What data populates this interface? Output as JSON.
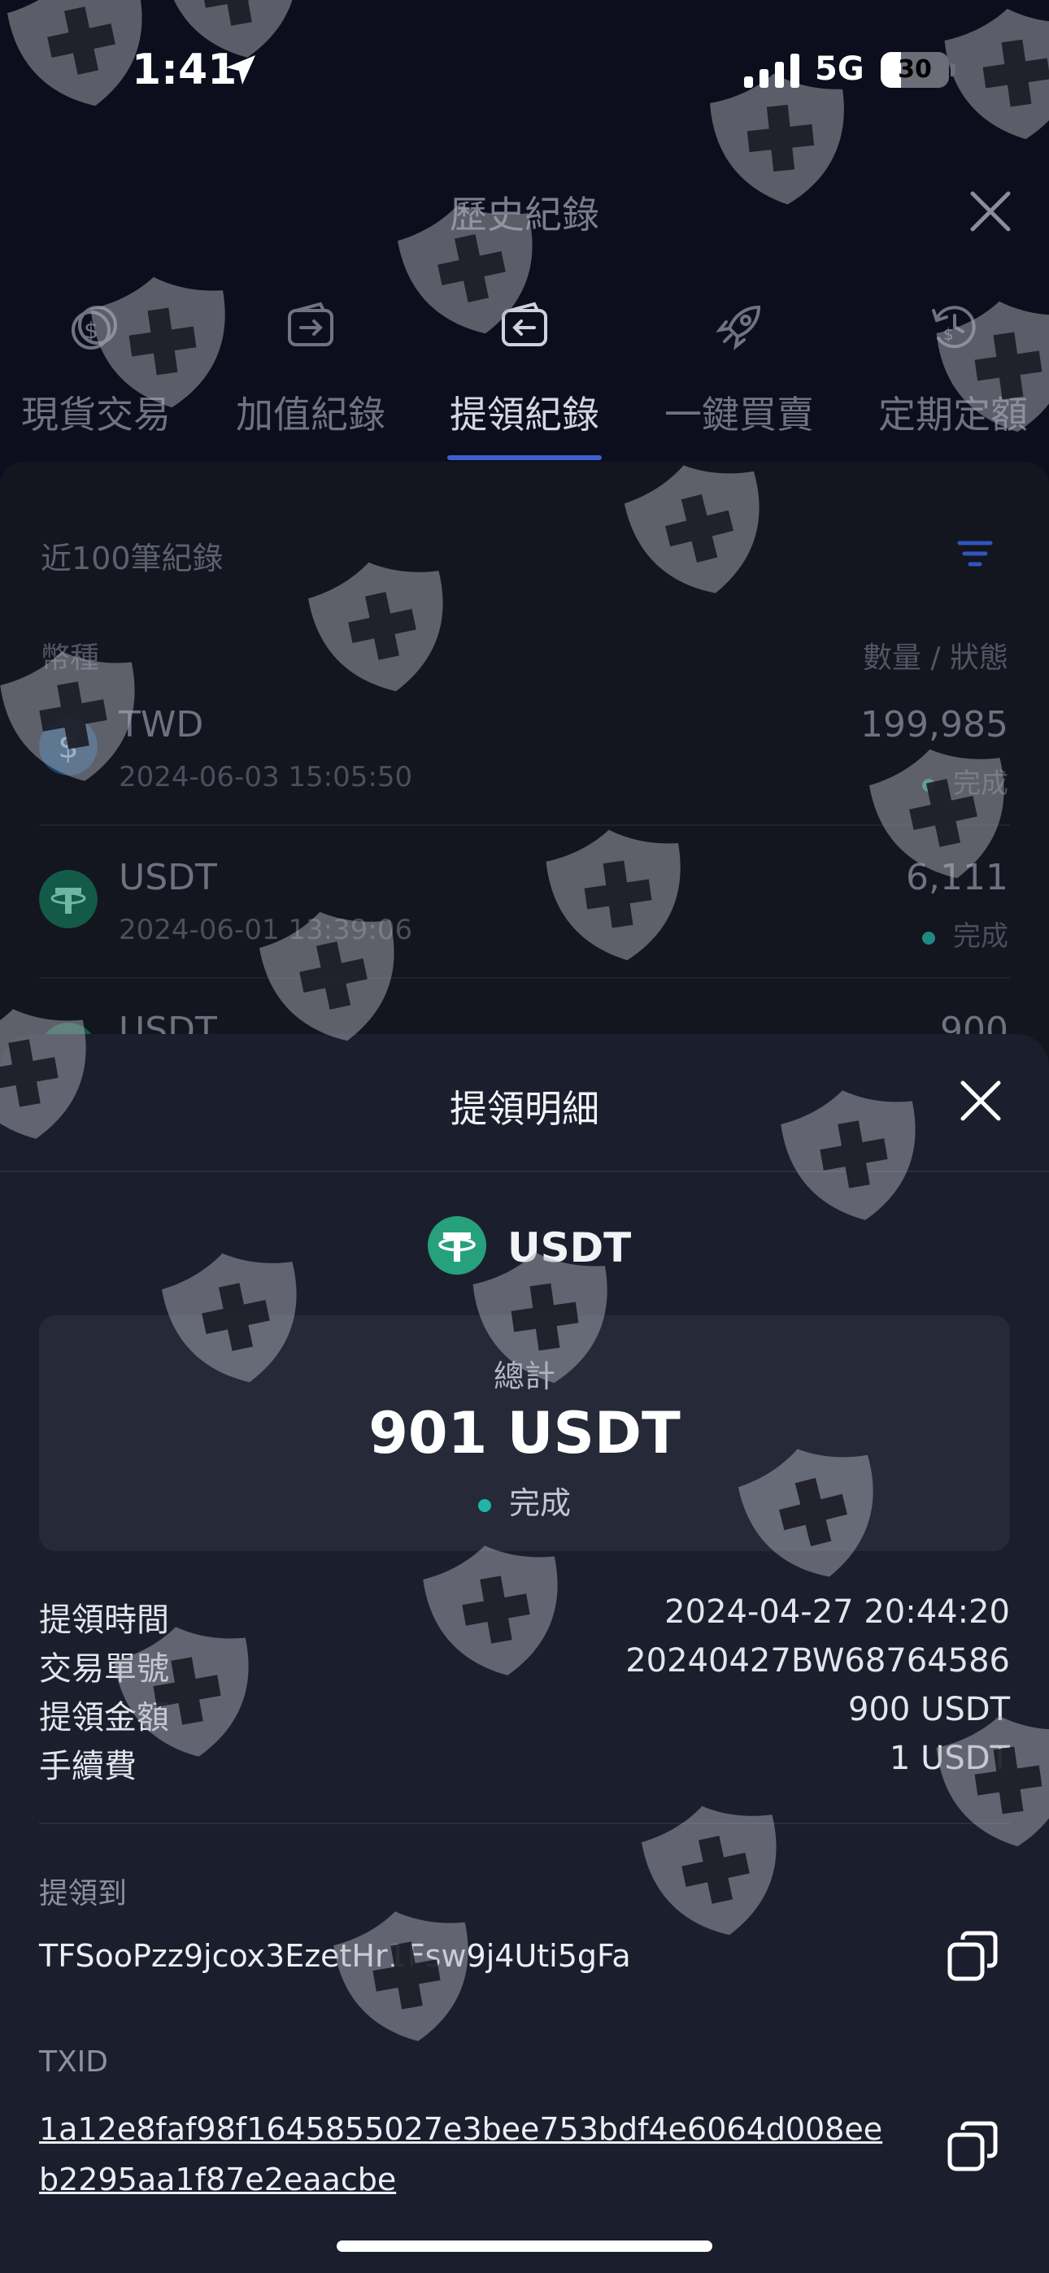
{
  "status_bar": {
    "time": "1:41",
    "network": "5G",
    "battery": "30",
    "battery_level": 0.3,
    "icons": [
      "location-arrow-icon",
      "cellular-signal-icon",
      "battery-icon"
    ]
  },
  "header": {
    "title": "歷史紀錄",
    "close_icon": "close-icon"
  },
  "tabs": [
    {
      "label": "現貨交易",
      "icon": "spot-trade-icon",
      "active": false
    },
    {
      "label": "加值紀錄",
      "icon": "deposit-wallet-icon",
      "active": false
    },
    {
      "label": "提領紀錄",
      "icon": "withdraw-wallet-icon",
      "active": true
    },
    {
      "label": "一鍵買賣",
      "icon": "rocket-icon",
      "active": false
    },
    {
      "label": "定期定額",
      "icon": "recurring-clock-icon",
      "active": false
    }
  ],
  "records_list": {
    "heading": "近100筆紀錄",
    "filter_icon": "filter-icon",
    "column_left": "幣種",
    "column_right": "數量 / 狀態",
    "rows": [
      {
        "currency": "TWD",
        "time": "2024-06-03 15:05:50",
        "amount": "199,985",
        "status": "完成",
        "icon": "twd-coin-icon"
      },
      {
        "currency": "USDT",
        "time": "2024-06-01 13:39:06",
        "amount": "6,111",
        "status": "完成",
        "icon": "usdt-coin-icon"
      },
      {
        "currency": "USDT",
        "time": "",
        "amount": "900",
        "status": "",
        "icon": "usdt-coin-icon"
      }
    ]
  },
  "detail_sheet": {
    "title": "提領明細",
    "close_icon": "close-icon",
    "coin": "USDT",
    "coin_icon": "usdt-coin-icon",
    "total_label": "總計",
    "total_value": "901 USDT",
    "status": "完成",
    "fields": [
      {
        "label": "提領時間",
        "value": "2024-04-27 20:44:20"
      },
      {
        "label": "交易單號",
        "value": "20240427BW68764586"
      },
      {
        "label": "提領金額",
        "value": "900 USDT"
      },
      {
        "label": "手續費",
        "value": "1 USDT"
      }
    ],
    "address_label": "提領到",
    "address": "TFSooPzz9jcox3EzetHr1Fsw9j4Uti5gFa",
    "txid_label": "TXID",
    "txid": "1a12e8faf98f1645855027e3bee753bdf4e6064d008eeb2295aa1f87e2eaacbe",
    "copy_icon": "copy-icon"
  },
  "colors": {
    "background": "#0c0e1d",
    "sheet": "#1b1e2c",
    "accent": "#3d5fd1",
    "usdt_green": "#26a17b",
    "status_teal": "#22b3a7",
    "twd_blue": "#2f7fd8"
  },
  "watermark_icon": "shield-plus-icon"
}
